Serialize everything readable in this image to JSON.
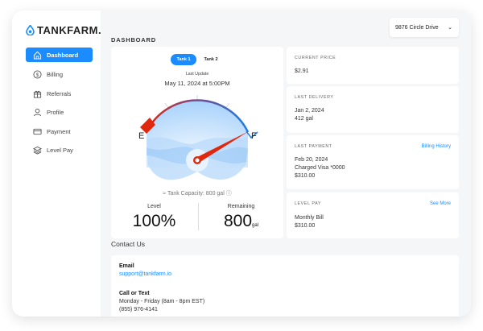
{
  "brand": "TANKFARM.",
  "sidebar": {
    "items": [
      {
        "label": "Dashboard",
        "icon": "home-icon"
      },
      {
        "label": "Billing",
        "icon": "dollar-icon"
      },
      {
        "label": "Referrals",
        "icon": "gift-icon"
      },
      {
        "label": "Profile",
        "icon": "user-icon"
      },
      {
        "label": "Payment",
        "icon": "credit-card-icon"
      },
      {
        "label": "Level Pay",
        "icon": "layers-icon"
      }
    ]
  },
  "header": {
    "title": "DASHBOARD",
    "address": "9876 Circle Drive"
  },
  "tank": {
    "tabs": [
      "Tank 1",
      "Tank 2"
    ],
    "active_tab": "Tank 1",
    "last_update_label": "Last Update",
    "last_update": "May 11, 2024 at 5:00PM",
    "empty": "E",
    "full": "F",
    "level_fraction": 1.0,
    "capacity": "Tank Capacity: 800 gal",
    "level_label": "Level",
    "level": "100%",
    "remaining_label": "Remaining",
    "remaining": "800",
    "remaining_unit": "gal"
  },
  "price": {
    "label": "CURRENT PRICE",
    "value": "$2.91"
  },
  "delivery": {
    "label": "LAST DELIVERY",
    "date": "Jan 2, 2024",
    "amount": "412 gal"
  },
  "payment": {
    "label": "LAST PAYMENT",
    "link": "Billing History",
    "date": "Feb 20, 2024",
    "method": "Charged Visa *0000",
    "amount": "$310.00"
  },
  "levelpay": {
    "label": "LEVEL PAY",
    "link": "See More",
    "name": "Monthly Bill",
    "amount": "$310.00"
  },
  "contact": {
    "title": "Contact Us",
    "email_label": "Email",
    "email": "support@tankfarm.io",
    "call_label": "Call or Text",
    "hours": "Monday - Friday (8am - 8pm EST)",
    "phone": "(855) 976-4141"
  },
  "colors": {
    "accent": "#1a8cff",
    "needle": "#e0280f"
  }
}
